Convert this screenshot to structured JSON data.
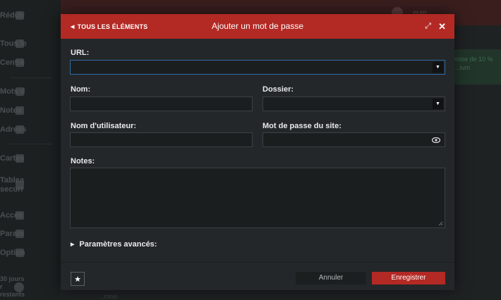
{
  "background": {
    "sidebar": {
      "items": [
        {
          "label": "Réduir",
          "icon": "arrow-left-icon"
        },
        {
          "label": "Tous le",
          "icon": "home-icon"
        },
        {
          "label": "Centre",
          "icon": "people-icon"
        },
        {
          "label": "Mots d",
          "icon": "lock-icon"
        },
        {
          "label": "Notes",
          "icon": "note-icon"
        },
        {
          "label": "Adress",
          "icon": "address-icon"
        },
        {
          "label": "Cartes",
          "icon": "card-icon"
        },
        {
          "label": "Tablea securi",
          "icon": "shield-icon"
        },
        {
          "label": "Accès",
          "icon": "access-icon"
        },
        {
          "label": "Param",
          "icon": "gear-icon"
        },
        {
          "label": "Option",
          "icon": "options-icon"
        }
      ],
      "bottom_label": "30 jours r restants"
    },
    "user_label": "...eum",
    "promo_text": "mise de 10 % ...ium",
    "page_text": "...mois"
  },
  "modal": {
    "back_link": "TOUS LES ÉLÉMENTS",
    "title": "Ajouter un mot de passe",
    "fields": {
      "url": {
        "label": "URL:",
        "value": ""
      },
      "name": {
        "label": "Nom:",
        "value": ""
      },
      "folder": {
        "label": "Dossier:",
        "value": ""
      },
      "username": {
        "label": "Nom d'utilisateur:",
        "value": ""
      },
      "password": {
        "label": "Mot de passe du site:",
        "value": ""
      },
      "notes": {
        "label": "Notes:",
        "value": ""
      }
    },
    "advanced_label": "Paramètres avancés:",
    "cancel_label": "Annuler",
    "save_label": "Enregistrer"
  },
  "colors": {
    "accent": "#b32924",
    "modal_bg": "#242729",
    "field_bg": "#1b1e1f",
    "focus_border": "#2f6aa8"
  }
}
